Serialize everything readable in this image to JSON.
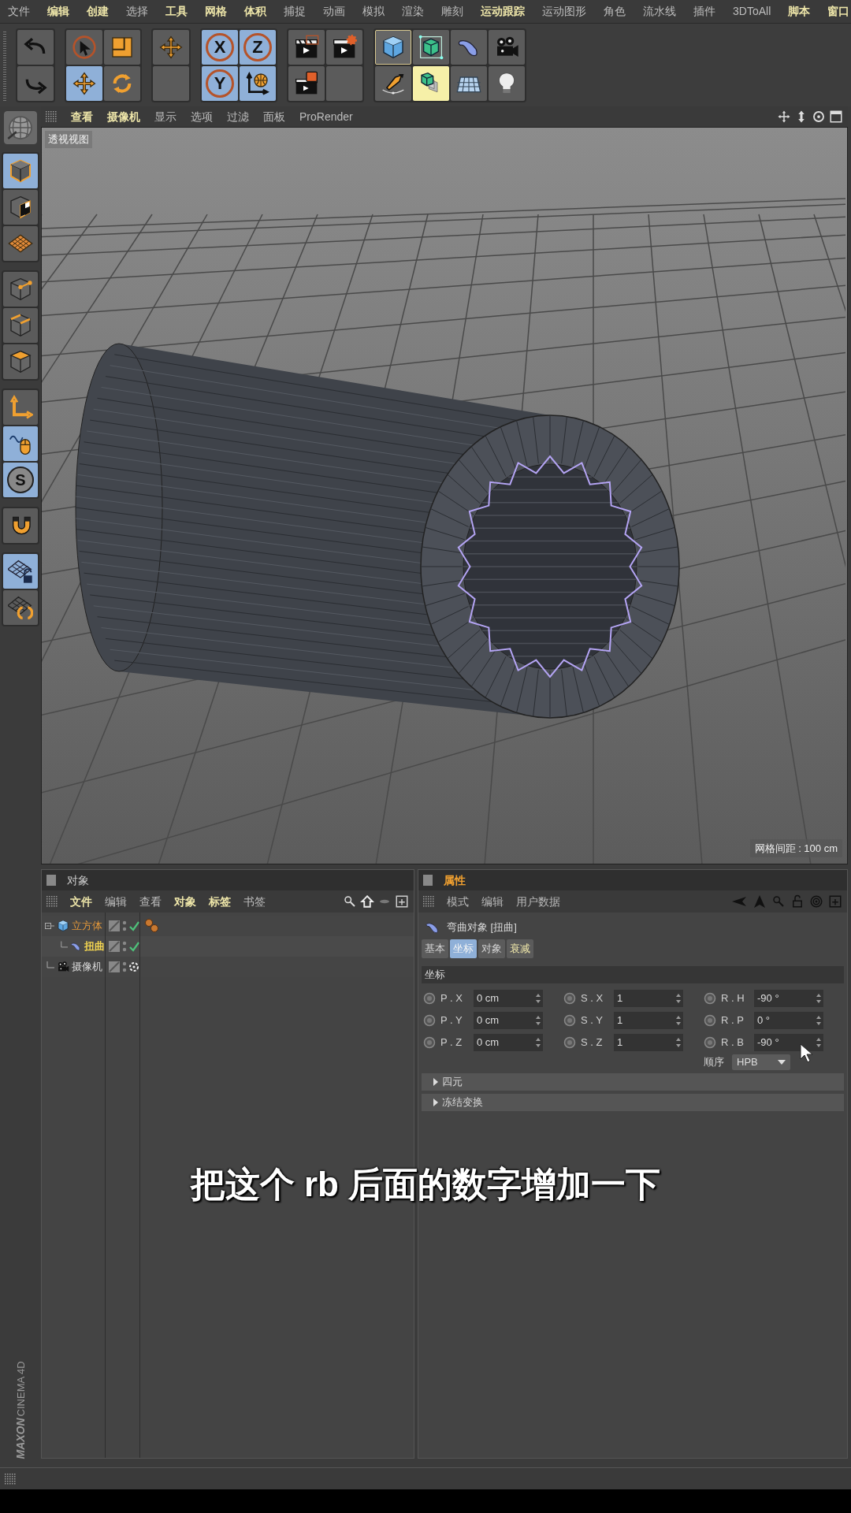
{
  "menu_bar": [
    {
      "label": "文件",
      "highlighted": false
    },
    {
      "label": "编辑",
      "highlighted": true
    },
    {
      "label": "创建",
      "highlighted": true
    },
    {
      "label": "选择",
      "highlighted": false
    },
    {
      "label": "工具",
      "highlighted": true
    },
    {
      "label": "网格",
      "highlighted": true
    },
    {
      "label": "体积",
      "highlighted": true
    },
    {
      "label": "捕捉",
      "highlighted": false
    },
    {
      "label": "动画",
      "highlighted": false
    },
    {
      "label": "模拟",
      "highlighted": false
    },
    {
      "label": "渲染",
      "highlighted": false
    },
    {
      "label": "雕刻",
      "highlighted": false
    },
    {
      "label": "运动跟踪",
      "highlighted": true
    },
    {
      "label": "运动图形",
      "highlighted": false
    },
    {
      "label": "角色",
      "highlighted": false
    },
    {
      "label": "流水线",
      "highlighted": false
    },
    {
      "label": "插件",
      "highlighted": false
    },
    {
      "label": "3DToAll",
      "highlighted": false
    },
    {
      "label": "脚本",
      "highlighted": true
    },
    {
      "label": "窗口",
      "highlighted": true
    }
  ],
  "toolbar": [
    {
      "buttons": [
        {
          "kind": "undo",
          "selected": false
        },
        {
          "kind": "redo",
          "selected": false
        }
      ]
    },
    {
      "buttons": [
        {
          "kind": "select",
          "selected": false
        },
        {
          "kind": "scale",
          "selected": false
        },
        {
          "kind": "move",
          "selected": true
        },
        {
          "kind": "rotate",
          "selected": false
        }
      ]
    },
    {
      "buttons": [
        {
          "kind": "move",
          "selected": false
        },
        {
          "kind": "empty",
          "selected": false
        }
      ]
    },
    {
      "buttons": [
        {
          "kind": "axis",
          "label": "X",
          "selected": true
        },
        {
          "kind": "axis",
          "label": "Z",
          "selected": true
        },
        {
          "kind": "axis",
          "label": "Y",
          "selected": true
        },
        {
          "kind": "coords",
          "selected": true
        }
      ]
    },
    {
      "buttons": [
        {
          "kind": "render-view",
          "selected": false
        },
        {
          "kind": "render-settings",
          "selected": false
        },
        {
          "kind": "render-picture",
          "selected": false
        },
        {
          "kind": "empty",
          "selected": false
        }
      ]
    },
    {
      "buttons": [
        {
          "kind": "cube",
          "selected": true
        },
        {
          "kind": "subdivide",
          "selected": false
        },
        {
          "kind": "deformer",
          "selected": false
        },
        {
          "kind": "camera",
          "selected": false
        },
        {
          "kind": "pen",
          "selected": false
        },
        {
          "kind": "extrude",
          "selected": true
        },
        {
          "kind": "floor",
          "selected": false
        },
        {
          "kind": "light",
          "selected": false
        }
      ]
    }
  ],
  "left_toolbar": [
    {
      "buttons": [
        {
          "kind": "model",
          "selected": true
        },
        {
          "kind": "texture",
          "selected": false
        },
        {
          "kind": "workplane",
          "selected": false
        }
      ]
    },
    {
      "buttons": [
        {
          "kind": "points",
          "selected": false
        },
        {
          "kind": "edges",
          "selected": false
        },
        {
          "kind": "polygons",
          "selected": false
        }
      ]
    },
    {
      "buttons": [
        {
          "kind": "axis-mode",
          "selected": false
        },
        {
          "kind": "tweak",
          "selected": true
        },
        {
          "kind": "snap",
          "label": "S",
          "selected": true
        }
      ]
    },
    {
      "buttons": [
        {
          "kind": "magnet",
          "selected": false
        }
      ]
    },
    {
      "buttons": [
        {
          "kind": "grid-lock",
          "selected": true
        },
        {
          "kind": "grid-loop",
          "selected": false
        }
      ]
    }
  ],
  "viewport": {
    "menu": [
      {
        "label": "查看",
        "highlighted": true
      },
      {
        "label": "摄像机",
        "highlighted": true
      },
      {
        "label": "显示",
        "highlighted": false
      },
      {
        "label": "选项",
        "highlighted": false
      },
      {
        "label": "过滤",
        "highlighted": false
      },
      {
        "label": "面板",
        "highlighted": false
      },
      {
        "label": "ProRender",
        "highlighted": false
      }
    ],
    "view_name": "透视视图",
    "grid_spacing": "网格间距 : 100 cm"
  },
  "object_manager": {
    "title": "对象",
    "menu": [
      {
        "label": "文件",
        "highlighted": true
      },
      {
        "label": "编辑",
        "highlighted": false
      },
      {
        "label": "查看",
        "highlighted": false
      },
      {
        "label": "对象",
        "highlighted": true
      },
      {
        "label": "标签",
        "highlighted": true
      },
      {
        "label": "书签",
        "highlighted": false
      }
    ],
    "objects": [
      {
        "name": "立方体",
        "kind": "cube",
        "selected": true,
        "active": false,
        "enabled": true,
        "has_tag": true,
        "children": [
          {
            "name": "扭曲",
            "kind": "deformer",
            "selected": false,
            "active": true,
            "enabled": true,
            "has_tag": false
          }
        ]
      },
      {
        "name": "摄像机",
        "kind": "camera",
        "selected": false,
        "active": false,
        "enabled": true,
        "has_tag": false
      }
    ]
  },
  "attribute_manager": {
    "title": "属性",
    "menu": [
      {
        "label": "模式"
      },
      {
        "label": "编辑"
      },
      {
        "label": "用户数据"
      }
    ],
    "object_title": "弯曲对象 [扭曲]",
    "tabs": [
      {
        "label": "基本",
        "selected": false,
        "highlighted": false
      },
      {
        "label": "坐标",
        "selected": true,
        "highlighted": false
      },
      {
        "label": "对象",
        "selected": false,
        "highlighted": false
      },
      {
        "label": "衰减",
        "selected": false,
        "highlighted": true
      }
    ],
    "section": "坐标",
    "fields": [
      [
        {
          "label": "P . X",
          "value": "0 cm"
        },
        {
          "label": "S . X",
          "value": "1"
        },
        {
          "label": "R . H",
          "value": "-90 °"
        }
      ],
      [
        {
          "label": "P . Y",
          "value": "0 cm"
        },
        {
          "label": "S . Y",
          "value": "1"
        },
        {
          "label": "R . P",
          "value": "0 °"
        }
      ],
      [
        {
          "label": "P . Z",
          "value": "0 cm"
        },
        {
          "label": "S . Z",
          "value": "1"
        },
        {
          "label": "R . B",
          "value": "-90 °"
        }
      ]
    ],
    "order": {
      "label": "顺序",
      "value": "HPB"
    },
    "groups": [
      {
        "label": "四元",
        "expanded": false
      },
      {
        "label": "冻结变换",
        "expanded": false
      }
    ]
  },
  "subtitle": "把这个 rb 后面的数字增加一下",
  "logo": {
    "brand": "MAXON",
    "product": "CINEMA 4D"
  }
}
